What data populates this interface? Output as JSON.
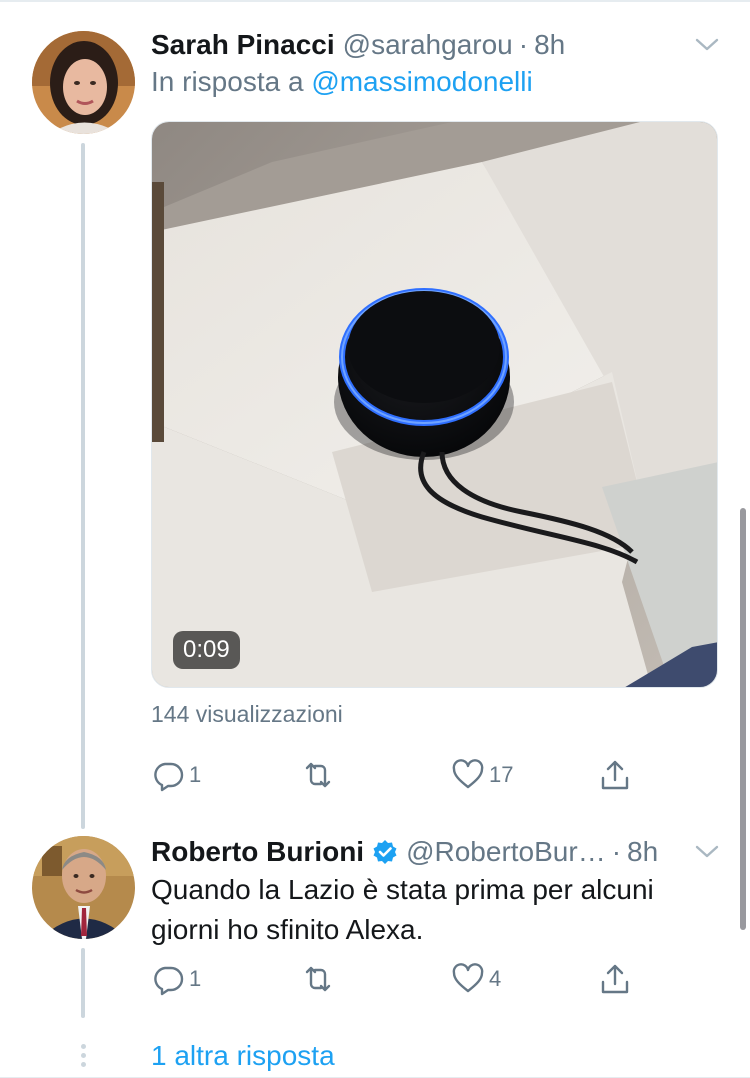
{
  "tweet1": {
    "name": "Sarah Pinacci",
    "handle": "@sarahgarou",
    "separator": "·",
    "time": "8h",
    "reply_prefix": "In risposta a",
    "reply_mention": "@massimodonelli",
    "video_duration": "0:09",
    "views": "144 visualizzazioni",
    "actions": {
      "reply_count": "1",
      "retweet_count": "",
      "like_count": "17"
    }
  },
  "tweet2": {
    "name": "Roberto Burioni",
    "handle": "@RobertoBur…",
    "separator": "·",
    "time": "8h",
    "text": "Quando la Lazio è stata prima per alcuni giorni ho sfinito Alexa.",
    "actions": {
      "reply_count": "1",
      "retweet_count": "",
      "like_count": "4"
    }
  },
  "thread": {
    "more_replies": "1 altra risposta"
  },
  "colors": {
    "accent": "#1da1f2",
    "secondary_text": "#657786",
    "thread_line": "#ccd6dd",
    "verified": "#1da1f2"
  },
  "icons": [
    "chevron-down-icon",
    "reply-icon",
    "retweet-icon",
    "like-icon",
    "share-icon",
    "verified-badge-icon",
    "play-duration-badge"
  ]
}
